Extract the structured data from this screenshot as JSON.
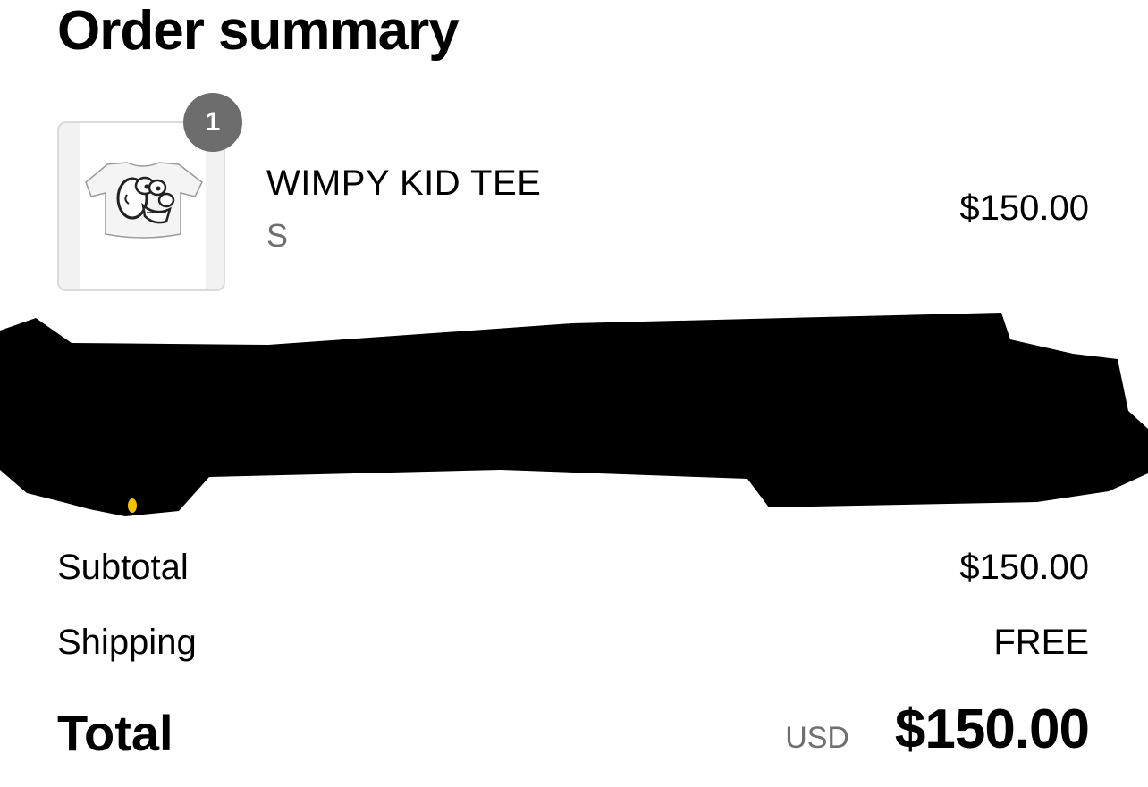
{
  "header": {
    "title": "Order summary"
  },
  "line_items": [
    {
      "name": "WIMPY KID TEE",
      "variant": "S",
      "price": "$150.00",
      "quantity": "1",
      "image_icon": "tshirt-cartoon-face-icon"
    }
  ],
  "summary": {
    "subtotal_label": "Subtotal",
    "subtotal_value": "$150.00",
    "shipping_label": "Shipping",
    "shipping_value": "FREE",
    "total_label": "Total",
    "currency": "USD",
    "total_value": "$150.00"
  },
  "colors": {
    "badge": "#6d6d6d",
    "muted_text": "#6f6f6f",
    "border": "#dadada"
  }
}
